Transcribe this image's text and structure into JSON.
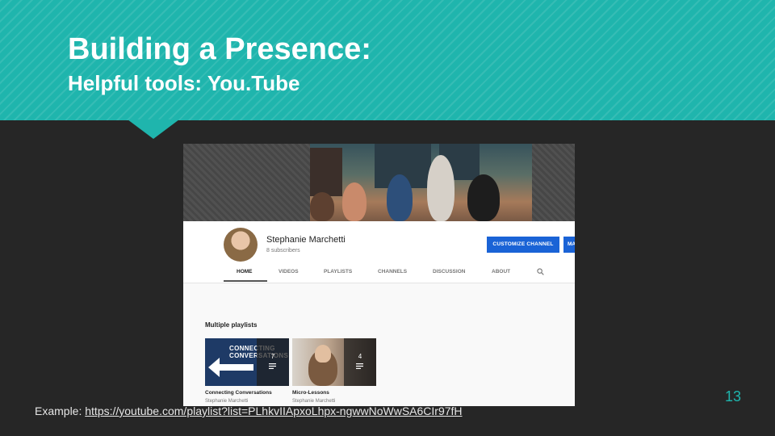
{
  "slide": {
    "title": "Building a Presence:",
    "subtitle": "Helpful tools: You.Tube",
    "example_label": "Example:",
    "example_link": "https://youtube.com/playlist?list=PLhkvIIApxoLhpx-ngwwNoWwSA6CIr97fH",
    "slide_number": "13",
    "colors": {
      "accent": "#1fb5ad",
      "background": "#262626",
      "button_blue": "#1a63d6"
    }
  },
  "youtube": {
    "channel_name": "Stephanie Marchetti",
    "subscribers": "8 subscribers",
    "customize_button": "CUSTOMIZE CHANNEL",
    "manage_button": "MA",
    "tabs": [
      {
        "label": "HOME",
        "active": true
      },
      {
        "label": "VIDEOS"
      },
      {
        "label": "PLAYLISTS"
      },
      {
        "label": "CHANNELS"
      },
      {
        "label": "DISCUSSION"
      },
      {
        "label": "ABOUT"
      }
    ],
    "search_icon": "search-icon",
    "section_title": "Multiple playlists",
    "playlists": [
      {
        "title": "Connecting Conversations",
        "author": "Stephanie Marchetti",
        "count": "7",
        "thumb_text": "CONNECTING\nCONVERSATIONS"
      },
      {
        "title": "Micro-Lessons",
        "author": "Stephanie Marchetti",
        "count": "4"
      }
    ]
  }
}
